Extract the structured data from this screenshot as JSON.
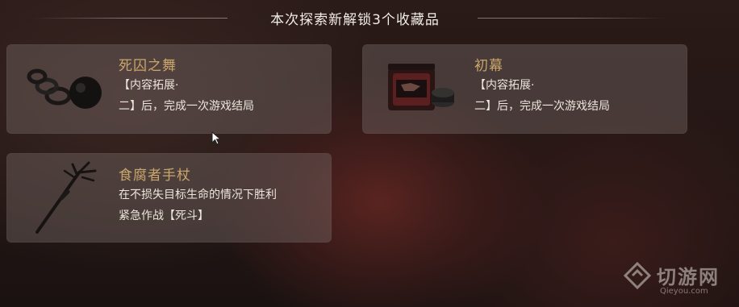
{
  "header": {
    "title": "本次探索新解锁3个收藏品"
  },
  "collectibles": [
    {
      "name": "死囚之舞",
      "description": "【内容拓展·\n二】后，完成一次游戏结局",
      "icon": "ball-and-chain-icon"
    },
    {
      "name": "初幕",
      "description": "【内容拓展·\n二】后，完成一次游戏结局",
      "icon": "music-box-icon"
    },
    {
      "name": "食腐者手杖",
      "description": "在不损失目标生命的情况下胜利\n紧急作战【死斗】",
      "icon": "scavenger-cane-icon"
    }
  ],
  "watermark": {
    "brand": "切游网",
    "url": "Qieyou.com"
  },
  "colors": {
    "item_name": "#c9a66b",
    "item_text": "#ece6dc",
    "card_bg": "rgba(120,108,104,0.42)"
  }
}
